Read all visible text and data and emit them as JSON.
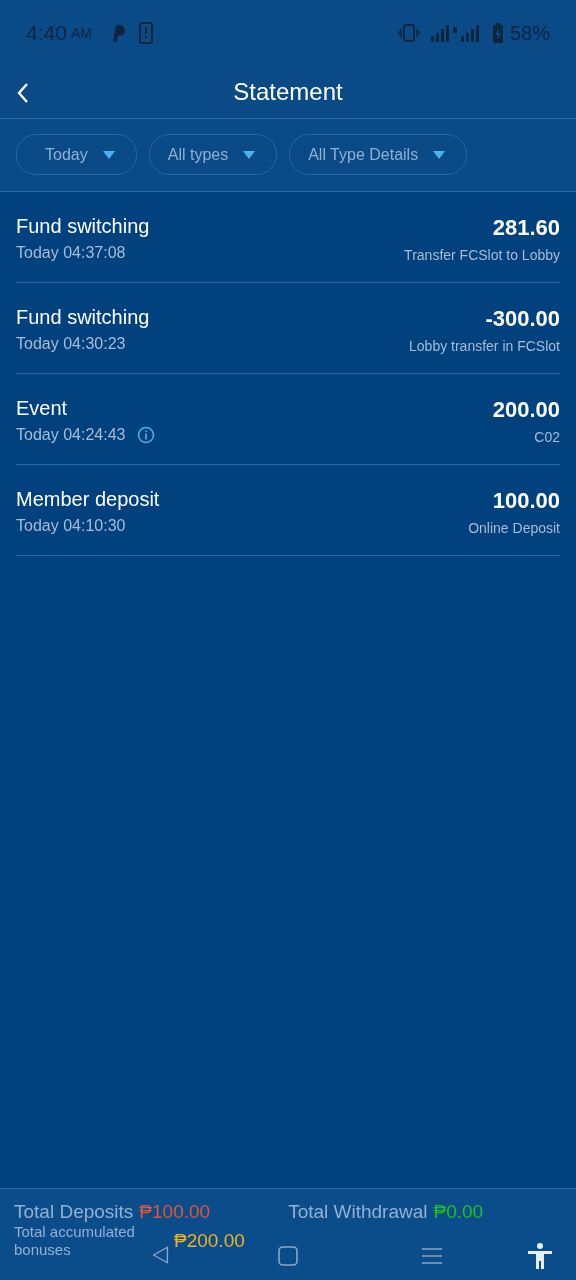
{
  "status_bar": {
    "time": "4:40",
    "period": "AM",
    "battery": "58%"
  },
  "header": {
    "title": "Statement"
  },
  "filters": [
    {
      "label": "Today"
    },
    {
      "label": "All types"
    },
    {
      "label": "All Type Details"
    }
  ],
  "transactions": [
    {
      "title": "Fund switching",
      "time": "Today 04:37:08",
      "amount": "281.60",
      "detail": "Transfer FCSlot to Lobby",
      "info": false
    },
    {
      "title": "Fund switching",
      "time": "Today 04:30:23",
      "amount": "-300.00",
      "detail": "Lobby transfer in FCSlot",
      "info": false
    },
    {
      "title": "Event",
      "time": "Today 04:24:43",
      "amount": "200.00",
      "detail": "C02",
      "info": true
    },
    {
      "title": "Member deposit",
      "time": "Today 04:10:30",
      "amount": "100.00",
      "detail": "Online Deposit",
      "info": false
    }
  ],
  "totals": [
    {
      "label": "Total Deposits",
      "value": "₱100.00",
      "color": "#e0553c"
    },
    {
      "label": "Total Withdrawal",
      "value": "₱0.00",
      "color": "#1fc01f"
    },
    {
      "label": "Total accumulated bonuses",
      "value": "₱200.00",
      "color": "#f0b020"
    }
  ]
}
